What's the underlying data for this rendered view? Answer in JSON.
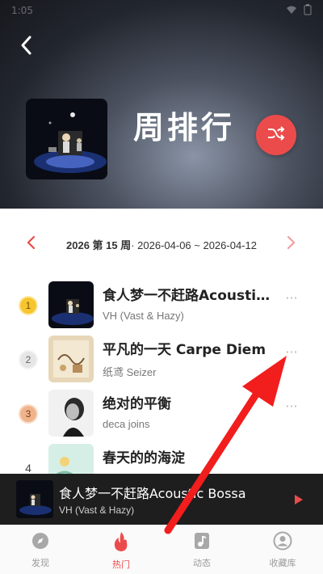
{
  "status_bar": {
    "time": "1:05",
    "battery": ""
  },
  "header": {
    "title": "周排行",
    "back_icon": "chevron-left-icon",
    "shuffle_icon": "shuffle-icon"
  },
  "week_selector": {
    "week_label": "2026 第 15 周",
    "date_range": "· 2026-04-06 ~ 2026-04-12"
  },
  "songs": [
    {
      "rank": "1",
      "title": "食人梦一不赶路Acoustic Bossa",
      "artist": "VH (Vast & Hazy)"
    },
    {
      "rank": "2",
      "title": "平凡的一天 Carpe Diem",
      "artist": "纸鸢 Seizer"
    },
    {
      "rank": "3",
      "title": "绝对的平衡",
      "artist": "deca joins"
    },
    {
      "rank": "4",
      "title": "春天的的海淀",
      "artist": ""
    }
  ],
  "mini_player": {
    "title": "食人梦一不赶路Acoustic Bossa",
    "artist": "VH (Vast & Hazy)"
  },
  "bottom_nav": [
    {
      "label": "发现",
      "icon": "compass-icon"
    },
    {
      "label": "热门",
      "icon": "flame-icon",
      "active": true
    },
    {
      "label": "动态",
      "icon": "music-note-icon"
    },
    {
      "label": "收藏库",
      "icon": "profile-icon"
    }
  ],
  "colors": {
    "accent": "#ec4b4b",
    "gold": "#f7c52e",
    "silver": "#e6e6e6",
    "bronze": "#f0b48c"
  }
}
